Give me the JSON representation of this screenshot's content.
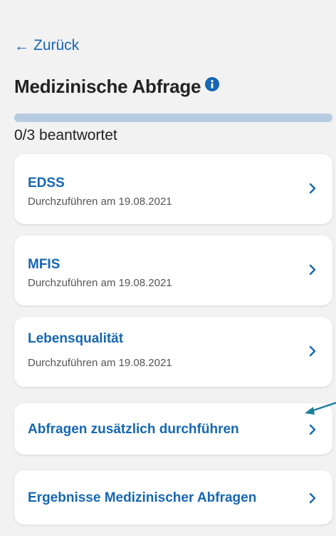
{
  "header": {
    "back_label": "Zurück",
    "title": "Medizinische Abfrage",
    "info_icon": "info-icon"
  },
  "progress": {
    "answered": 0,
    "total": 3,
    "fraction": 0,
    "label": "0/3 beantwortet"
  },
  "questionnaires": [
    {
      "title": "EDSS",
      "subtitle": "Durchzuführen am 19.08.2021"
    },
    {
      "title": "MFIS",
      "subtitle": "Durchzuführen am 19.08.2021"
    },
    {
      "title": "Lebensqualität",
      "subtitle": "Durchzuführen am 19.08.2021"
    }
  ],
  "actions": {
    "additional_label": "Abfragen zusätzlich durchführen",
    "results_label": "Ergebnisse Medizinischer Abfragen"
  },
  "colors": {
    "accent": "#1667b4",
    "progress_track": "#b7cce1",
    "background": "#f2f2f2",
    "annotation_arrow": "#1a7f9a"
  }
}
